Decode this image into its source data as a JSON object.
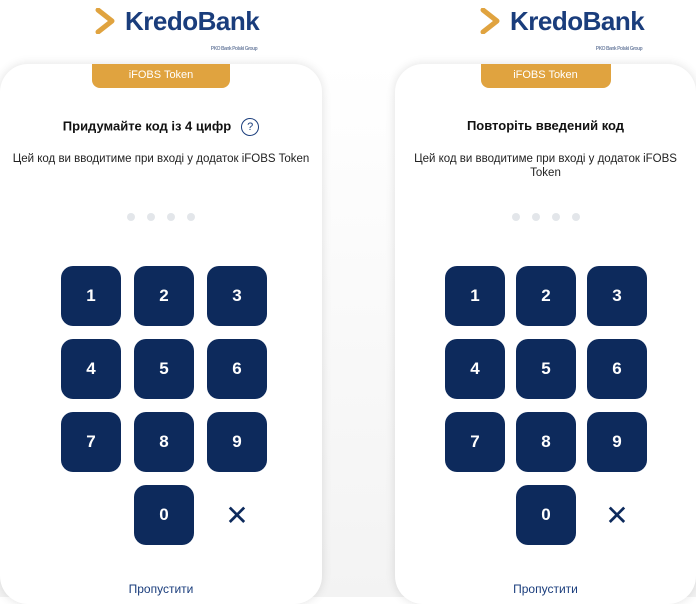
{
  "left": {
    "brand": "KredoBank",
    "brand_sub": "PKO Bank Polski Group",
    "tab_label": "iFOBS Token",
    "title": "Придумайте код із 4 цифр",
    "help_symbol": "?",
    "description": "Цей код ви вводитиме при вході у додаток iFOBS Token",
    "keys": [
      "1",
      "2",
      "3",
      "4",
      "5",
      "6",
      "7",
      "8",
      "9",
      "0"
    ],
    "delete_symbol": "✕",
    "skip_label": "Пропустити"
  },
  "right": {
    "brand": "KredoBank",
    "brand_sub": "PKO Bank Polski Group",
    "tab_label": "iFOBS Token",
    "title": "Повторіть введений код",
    "description": "Цей код ви вводитиме при вході у додаток iFOBS Token",
    "keys": [
      "1",
      "2",
      "3",
      "4",
      "5",
      "6",
      "7",
      "8",
      "9",
      "0"
    ],
    "delete_symbol": "✕",
    "skip_label": "Пропустити"
  },
  "colors": {
    "brand_blue": "#1a3d7c",
    "key_blue": "#0d2a5c",
    "accent_orange": "#e0a33f",
    "dot_gray": "#e3e6ea"
  }
}
